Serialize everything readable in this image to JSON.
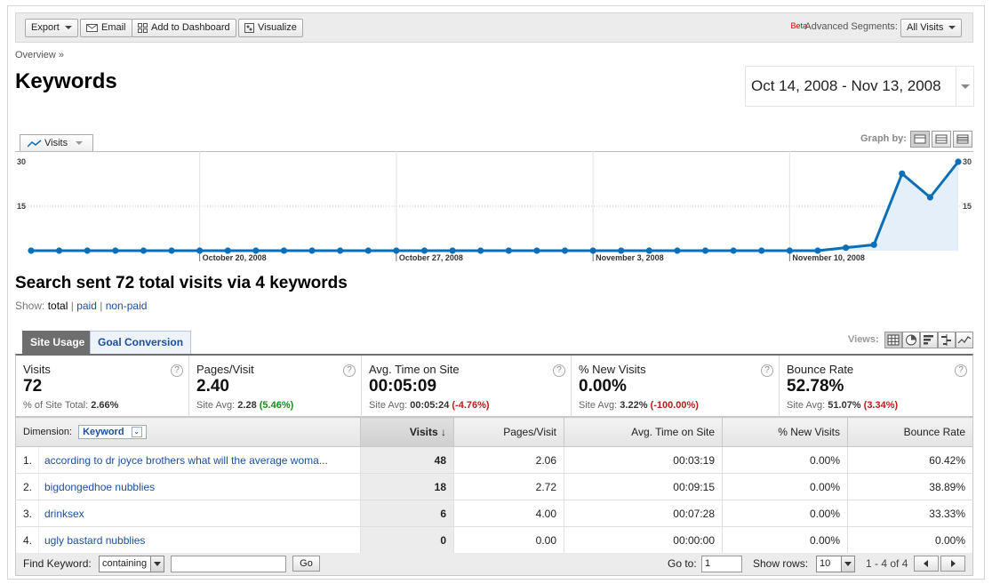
{
  "toolbar": {
    "export": "Export",
    "email": "Email",
    "add_dashboard": "Add to Dashboard",
    "visualize": "Visualize",
    "beta": "Beta",
    "advanced_segments_label": "Advanced Segments:",
    "advanced_segments_value": "All Visits"
  },
  "breadcrumb": "Overview »",
  "page_title": "Keywords",
  "date_range": "Oct 14, 2008 - Nov 13, 2008",
  "graph": {
    "metric": "Visits",
    "graph_by_label": "Graph by:"
  },
  "chart_data": {
    "type": "area",
    "series": [
      {
        "name": "Visits",
        "values": [
          0,
          0,
          0,
          0,
          0,
          0,
          0,
          0,
          0,
          0,
          0,
          0,
          0,
          0,
          0,
          0,
          0,
          0,
          0,
          0,
          0,
          0,
          0,
          0,
          0,
          0,
          0,
          0,
          0,
          1,
          2,
          26,
          18,
          30
        ]
      }
    ],
    "x": [
      "Oct 14",
      "Oct 15",
      "Oct 16",
      "Oct 17",
      "Oct 18",
      "Oct 19",
      "Oct 20",
      "Oct 21",
      "Oct 22",
      "Oct 23",
      "Oct 24",
      "Oct 25",
      "Oct 26",
      "Oct 27",
      "Oct 28",
      "Oct 29",
      "Oct 30",
      "Oct 31",
      "Nov 1",
      "Nov 2",
      "Nov 3",
      "Nov 4",
      "Nov 5",
      "Nov 6",
      "Nov 7",
      "Nov 8",
      "Nov 9",
      "Nov 10",
      "Nov 11",
      "Nov 12",
      "Nov 13"
    ],
    "x_tick_labels": [
      {
        "index": 6,
        "label": "October 20, 2008"
      },
      {
        "index": 13,
        "label": "October 27, 2008"
      },
      {
        "index": 20,
        "label": "November 3, 2008"
      },
      {
        "index": 27,
        "label": "November 10, 2008"
      }
    ],
    "y_ticks": [
      "30",
      "15"
    ],
    "ylim": [
      0,
      30
    ],
    "color": "#0b6fb8",
    "fill": "#e4eff9"
  },
  "summary": {
    "title": "Search sent 72 total visits via 4 keywords",
    "show_label": "Show:",
    "show_total": "total",
    "sep1": "|",
    "show_paid": "paid",
    "sep2": "|",
    "show_nonpaid": "non-paid"
  },
  "tabs": {
    "site_usage": "Site Usage",
    "goal_conversion": "Goal Conversion",
    "views_label": "Views:"
  },
  "scorecard": [
    {
      "label": "Visits",
      "value": "72",
      "sub_prefix": "% of Site Total:",
      "sub_value": "2.66%",
      "sub_delta": "",
      "delta_class": ""
    },
    {
      "label": "Pages/Visit",
      "value": "2.40",
      "sub_prefix": "Site Avg:",
      "sub_value": "2.28",
      "sub_delta": "(5.46%)",
      "delta_class": "pos"
    },
    {
      "label": "Avg. Time on Site",
      "value": "00:05:09",
      "sub_prefix": "Site Avg:",
      "sub_value": "00:05:24",
      "sub_delta": "(-4.76%)",
      "delta_class": "neg"
    },
    {
      "label": "% New Visits",
      "value": "0.00%",
      "sub_prefix": "Site Avg:",
      "sub_value": "3.22%",
      "sub_delta": "(-100.00%)",
      "delta_class": "neg"
    },
    {
      "label": "Bounce Rate",
      "value": "52.78%",
      "sub_prefix": "Site Avg:",
      "sub_value": "51.07%",
      "sub_delta": "(3.34%)",
      "delta_class": "neg"
    }
  ],
  "table": {
    "dimension_label": "Dimension:",
    "dimension_value": "Keyword",
    "headers": [
      "Visits",
      "Pages/Visit",
      "Avg. Time on Site",
      "% New Visits",
      "Bounce Rate"
    ],
    "sort_arrow": "↓",
    "rows": [
      {
        "num": "1.",
        "keyword": "according to dr joyce brothers what will the average woma...",
        "visits": "48",
        "ppv": "2.06",
        "time": "00:03:19",
        "new": "0.00%",
        "bounce": "60.42%"
      },
      {
        "num": "2.",
        "keyword": "bigdongedhoe nubblies",
        "visits": "18",
        "ppv": "2.72",
        "time": "00:09:15",
        "new": "0.00%",
        "bounce": "38.89%"
      },
      {
        "num": "3.",
        "keyword": "drinksex",
        "visits": "6",
        "ppv": "4.00",
        "time": "00:07:28",
        "new": "0.00%",
        "bounce": "33.33%"
      },
      {
        "num": "4.",
        "keyword": "ugly bastard nubblies",
        "visits": "0",
        "ppv": "0.00",
        "time": "00:00:00",
        "new": "0.00%",
        "bounce": "0.00%"
      }
    ]
  },
  "footer": {
    "find_keyword_label": "Find Keyword:",
    "match_type": "containing",
    "find_value": "",
    "go": "Go",
    "goto_label": "Go to:",
    "goto_value": "1",
    "show_rows_label": "Show rows:",
    "show_rows_value": "10",
    "range": "1 - 4 of 4"
  }
}
